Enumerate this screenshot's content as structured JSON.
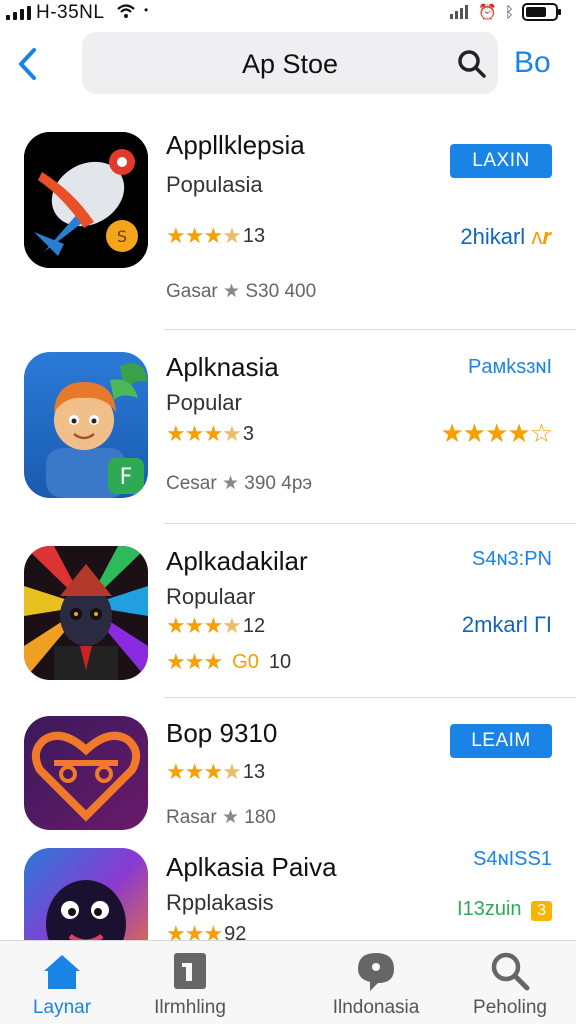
{
  "status_bar": {
    "time": "H-35NL",
    "wifi_icon": "wifi-icon",
    "right_icons": [
      "cellular-icon",
      "alarm-icon",
      "bluetooth-icon",
      "battery-icon"
    ]
  },
  "nav": {
    "back_icon": "chevron-left-icon",
    "search_title": "Ap Stoe",
    "search_icon": "search-icon",
    "right_label": "Bo"
  },
  "apps": [
    {
      "name": "Appllklepsia",
      "subtitle": "Populasia",
      "rating_count": "13",
      "stars": 3.5,
      "meta_prefix": "Gasar",
      "meta_suffix": "S30 400",
      "action_label": "LAXIN",
      "right_label": "2hikarl",
      "right_extra": "ʌ𝒓"
    },
    {
      "name": "Aplknasia",
      "subtitle": "Popular",
      "rating_count": "3",
      "stars": 3.5,
      "meta_prefix": "Cesar",
      "meta_suffix": "390 4рэ",
      "right_label": "PaмkѕɜɴI",
      "right_stars": "★★★★☆"
    },
    {
      "name": "Aplkadakilar",
      "subtitle": "Ropulaar",
      "rating_count": "12",
      "stars": 3.5,
      "rating2_badge": "G0",
      "rating2_count": "10",
      "right_label": "S4ɴ3:PN",
      "right_label2": "2mkarl",
      "right_extra": "ГI"
    },
    {
      "name": "Bop 9310",
      "rating_count": "13",
      "stars": 3.5,
      "meta_prefix": "Rasar",
      "meta_suffix": "180",
      "action_label": "LEAIM"
    },
    {
      "name": "Aplkasia Paiva",
      "subtitle": "Rpplakasis",
      "rating_count": "92",
      "stars": 3.5,
      "right_label": "S4ɴISS1",
      "right_label2": "I13zuin",
      "badge_label": "3"
    }
  ],
  "tabs": [
    {
      "label": "Laynar",
      "icon": "home-icon",
      "active": true
    },
    {
      "label": "Ilrmhling",
      "icon": "square-icon",
      "active": false
    },
    {
      "label": "Ilndonasia",
      "icon": "chat-icon",
      "active": false
    },
    {
      "label": "Peholing",
      "icon": "search-icon",
      "active": false
    }
  ],
  "colors": {
    "accent": "#1a84e6",
    "star": "#f5a000",
    "tab_bar": "#f7f7f7"
  }
}
